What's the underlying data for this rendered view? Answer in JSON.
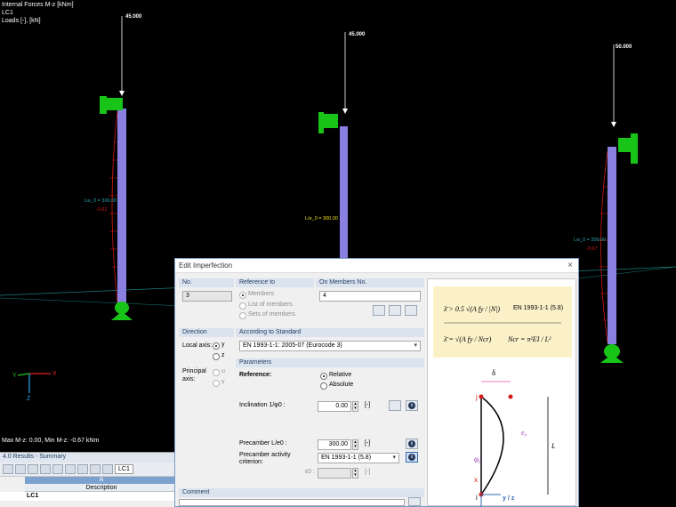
{
  "viewport": {
    "overlay_lines": [
      "Internal Forces M-z [kNm]",
      "LC1",
      "Loads [-], [kN]"
    ],
    "summary": "Max M-z: 0.00, Min M-z: -0.67 kNm",
    "loads": [
      "45.000",
      "45.000",
      "50.000"
    ],
    "imperfection_labels": [
      "Lw_0 = 300.00",
      "L/e_0 = 300.00",
      "Lw_0 = 300.00"
    ],
    "moment_values": [
      "-0.62",
      "-0.67"
    ],
    "axes": {
      "x": "X",
      "y": "Y",
      "z": "Z"
    }
  },
  "results": {
    "title": "4.0 Results - Summary",
    "lc": "LC1",
    "col_a": "A",
    "col_desc": "Description",
    "row": "LC1"
  },
  "dialog": {
    "title": "Edit Imperfection",
    "close": "×",
    "no": {
      "header": "No.",
      "value": "3"
    },
    "reference_to": {
      "header": "Reference to",
      "options": [
        "Members",
        "List of members",
        "Sets of members"
      ]
    },
    "on_members": {
      "header": "On Members No.",
      "value": "4"
    },
    "direction": {
      "header": "Direction",
      "local_axis": "Local axis:",
      "y": "y",
      "z": "z",
      "principal_axis": "Principal axis:",
      "u": "u",
      "v": "v"
    },
    "standard": {
      "header": "According to Standard",
      "value": "EN 1993-1-1: 2005-07  (Eurocode 3)"
    },
    "parameters": {
      "header": "Parameters",
      "reference_label": "Reference:",
      "relative": "Relative",
      "absolute": "Absolute",
      "inclination_label": "Inclination 1/φ0 :",
      "inclination_value": "0.00",
      "inclination_unit": "[-]",
      "precamber_label": "Precamber L/e0 :",
      "precamber_value": "300.00",
      "precamber_unit": "[-]",
      "activity_label": "Precamber activity criterion:",
      "activity_value": "EN 1993-1-1 (5.8)",
      "e0_label": "ε0 :",
      "e0_unit": "[-]"
    },
    "comment_header": "Comment",
    "formula": {
      "f1_text": "EN 1993-1-1 (5.8)"
    }
  },
  "colors": {
    "column": "#8a80e0",
    "support": "#19c419",
    "moment": "#d11a1a",
    "accent": "#2f68b0"
  }
}
